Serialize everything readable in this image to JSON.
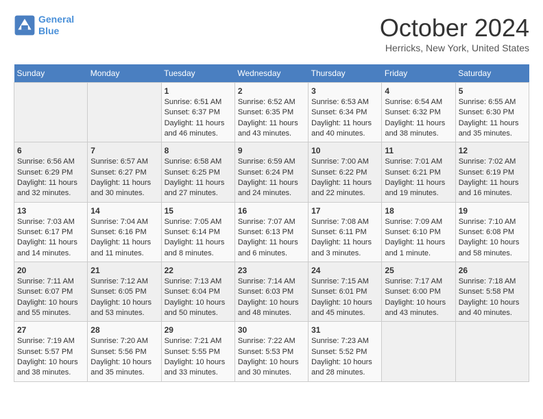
{
  "header": {
    "logo_line1": "General",
    "logo_line2": "Blue",
    "month": "October 2024",
    "location": "Herricks, New York, United States"
  },
  "weekdays": [
    "Sunday",
    "Monday",
    "Tuesday",
    "Wednesday",
    "Thursday",
    "Friday",
    "Saturday"
  ],
  "weeks": [
    [
      {
        "day": "",
        "info": ""
      },
      {
        "day": "",
        "info": ""
      },
      {
        "day": "1",
        "info": "Sunrise: 6:51 AM\nSunset: 6:37 PM\nDaylight: 11 hours and 46 minutes."
      },
      {
        "day": "2",
        "info": "Sunrise: 6:52 AM\nSunset: 6:35 PM\nDaylight: 11 hours and 43 minutes."
      },
      {
        "day": "3",
        "info": "Sunrise: 6:53 AM\nSunset: 6:34 PM\nDaylight: 11 hours and 40 minutes."
      },
      {
        "day": "4",
        "info": "Sunrise: 6:54 AM\nSunset: 6:32 PM\nDaylight: 11 hours and 38 minutes."
      },
      {
        "day": "5",
        "info": "Sunrise: 6:55 AM\nSunset: 6:30 PM\nDaylight: 11 hours and 35 minutes."
      }
    ],
    [
      {
        "day": "6",
        "info": "Sunrise: 6:56 AM\nSunset: 6:29 PM\nDaylight: 11 hours and 32 minutes."
      },
      {
        "day": "7",
        "info": "Sunrise: 6:57 AM\nSunset: 6:27 PM\nDaylight: 11 hours and 30 minutes."
      },
      {
        "day": "8",
        "info": "Sunrise: 6:58 AM\nSunset: 6:25 PM\nDaylight: 11 hours and 27 minutes."
      },
      {
        "day": "9",
        "info": "Sunrise: 6:59 AM\nSunset: 6:24 PM\nDaylight: 11 hours and 24 minutes."
      },
      {
        "day": "10",
        "info": "Sunrise: 7:00 AM\nSunset: 6:22 PM\nDaylight: 11 hours and 22 minutes."
      },
      {
        "day": "11",
        "info": "Sunrise: 7:01 AM\nSunset: 6:21 PM\nDaylight: 11 hours and 19 minutes."
      },
      {
        "day": "12",
        "info": "Sunrise: 7:02 AM\nSunset: 6:19 PM\nDaylight: 11 hours and 16 minutes."
      }
    ],
    [
      {
        "day": "13",
        "info": "Sunrise: 7:03 AM\nSunset: 6:17 PM\nDaylight: 11 hours and 14 minutes."
      },
      {
        "day": "14",
        "info": "Sunrise: 7:04 AM\nSunset: 6:16 PM\nDaylight: 11 hours and 11 minutes."
      },
      {
        "day": "15",
        "info": "Sunrise: 7:05 AM\nSunset: 6:14 PM\nDaylight: 11 hours and 8 minutes."
      },
      {
        "day": "16",
        "info": "Sunrise: 7:07 AM\nSunset: 6:13 PM\nDaylight: 11 hours and 6 minutes."
      },
      {
        "day": "17",
        "info": "Sunrise: 7:08 AM\nSunset: 6:11 PM\nDaylight: 11 hours and 3 minutes."
      },
      {
        "day": "18",
        "info": "Sunrise: 7:09 AM\nSunset: 6:10 PM\nDaylight: 11 hours and 1 minute."
      },
      {
        "day": "19",
        "info": "Sunrise: 7:10 AM\nSunset: 6:08 PM\nDaylight: 10 hours and 58 minutes."
      }
    ],
    [
      {
        "day": "20",
        "info": "Sunrise: 7:11 AM\nSunset: 6:07 PM\nDaylight: 10 hours and 55 minutes."
      },
      {
        "day": "21",
        "info": "Sunrise: 7:12 AM\nSunset: 6:05 PM\nDaylight: 10 hours and 53 minutes."
      },
      {
        "day": "22",
        "info": "Sunrise: 7:13 AM\nSunset: 6:04 PM\nDaylight: 10 hours and 50 minutes."
      },
      {
        "day": "23",
        "info": "Sunrise: 7:14 AM\nSunset: 6:03 PM\nDaylight: 10 hours and 48 minutes."
      },
      {
        "day": "24",
        "info": "Sunrise: 7:15 AM\nSunset: 6:01 PM\nDaylight: 10 hours and 45 minutes."
      },
      {
        "day": "25",
        "info": "Sunrise: 7:17 AM\nSunset: 6:00 PM\nDaylight: 10 hours and 43 minutes."
      },
      {
        "day": "26",
        "info": "Sunrise: 7:18 AM\nSunset: 5:58 PM\nDaylight: 10 hours and 40 minutes."
      }
    ],
    [
      {
        "day": "27",
        "info": "Sunrise: 7:19 AM\nSunset: 5:57 PM\nDaylight: 10 hours and 38 minutes."
      },
      {
        "day": "28",
        "info": "Sunrise: 7:20 AM\nSunset: 5:56 PM\nDaylight: 10 hours and 35 minutes."
      },
      {
        "day": "29",
        "info": "Sunrise: 7:21 AM\nSunset: 5:55 PM\nDaylight: 10 hours and 33 minutes."
      },
      {
        "day": "30",
        "info": "Sunrise: 7:22 AM\nSunset: 5:53 PM\nDaylight: 10 hours and 30 minutes."
      },
      {
        "day": "31",
        "info": "Sunrise: 7:23 AM\nSunset: 5:52 PM\nDaylight: 10 hours and 28 minutes."
      },
      {
        "day": "",
        "info": ""
      },
      {
        "day": "",
        "info": ""
      }
    ]
  ]
}
